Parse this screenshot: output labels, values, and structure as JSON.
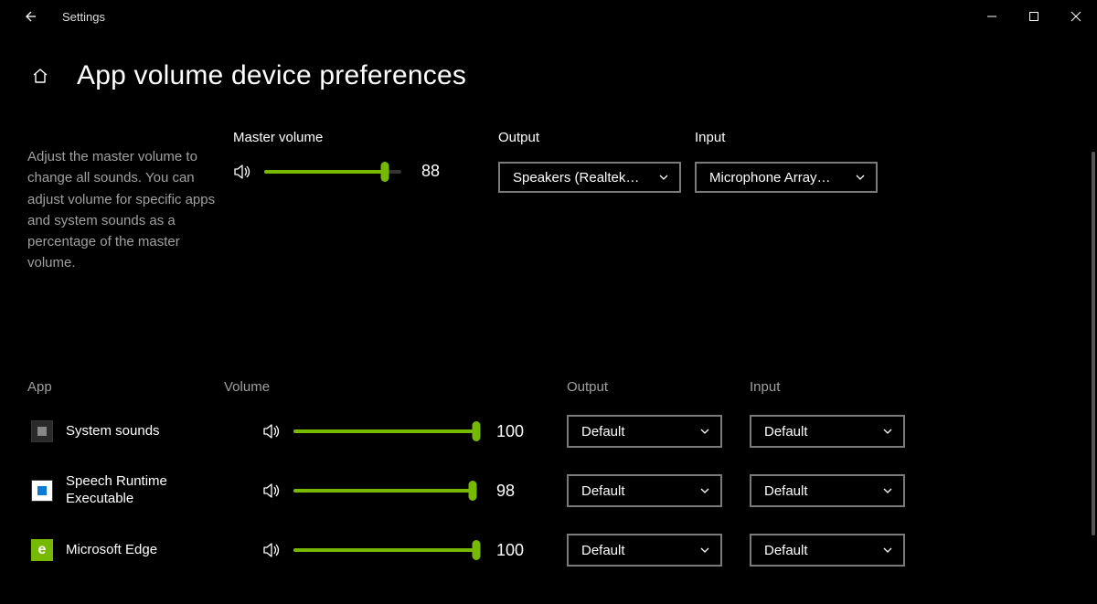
{
  "window": {
    "title": "Settings"
  },
  "page": {
    "heading": "App volume  device preferences",
    "description": "Adjust the master volume to change all sounds. You can adjust volume for specific apps and system sounds as a percentage of the master volume."
  },
  "master": {
    "volume_label": "Master volume",
    "output_label": "Output",
    "input_label": "Input",
    "volume_value": "88",
    "volume_percent": 88,
    "output_value": "Speakers (Realtek…",
    "input_value": "Microphone Array…"
  },
  "apps_header": {
    "app": "App",
    "volume": "Volume",
    "output": "Output",
    "input": "Input"
  },
  "apps": [
    {
      "name": "System sounds",
      "volume_value": "100",
      "volume_percent": 100,
      "output": "Default",
      "input": "Default",
      "icon_bg": "#2a2a2a",
      "icon_inner": "#888",
      "icon_glyph": ""
    },
    {
      "name": "Speech Runtime Executable",
      "volume_value": "98",
      "volume_percent": 98,
      "output": "Default",
      "input": "Default",
      "icon_bg": "#ffffff",
      "icon_inner": "#0a7bd6",
      "icon_glyph": ""
    },
    {
      "name": "Microsoft Edge",
      "volume_value": "100",
      "volume_percent": 100,
      "output": "Default",
      "input": "Default",
      "icon_bg": "#76B900",
      "icon_inner": "#ffffff",
      "icon_glyph": "e"
    }
  ]
}
